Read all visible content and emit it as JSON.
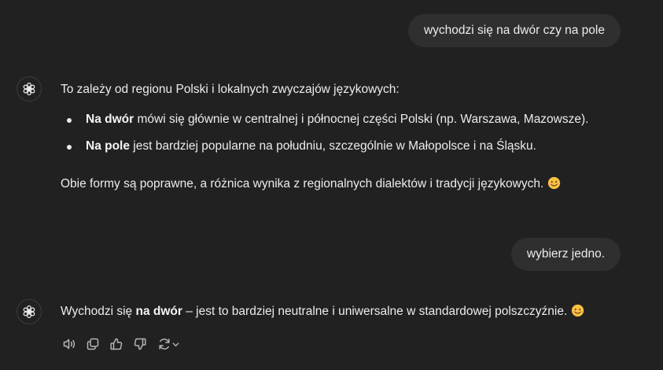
{
  "conversation": [
    {
      "role": "user",
      "text": "wychodzi się na dwór czy na pole"
    },
    {
      "role": "assistant",
      "intro": "To zależy od regionu Polski i lokalnych zwyczajów językowych:",
      "bullets": [
        {
          "bold": "Na dwór",
          "text": " mówi się głównie w centralnej i północnej części Polski (np. Warszawa, Mazowsze)."
        },
        {
          "bold": "Na pole",
          "text": " jest bardziej popularne na południu, szczególnie w Małopolsce i na Śląsku."
        }
      ],
      "outro": "Obie formy są poprawne, a różnica wynika z regionalnych dialektów i tradycji językowych.",
      "emoji": "smiling-face-emoji"
    },
    {
      "role": "user",
      "text": "wybierz jedno."
    },
    {
      "role": "assistant",
      "prefix": "Wychodzi się ",
      "bold": "na dwór",
      "suffix": " – jest to bardziej neutralne i uniwersalne w standardowej polszczyźnie.",
      "emoji": "smiling-face-emoji"
    }
  ],
  "action_icons": [
    "read-aloud-icon",
    "copy-icon",
    "thumbs-up-icon",
    "thumbs-down-icon",
    "regenerate-icon",
    "chevron-down-icon"
  ],
  "colors": {
    "background": "#212121",
    "user_bubble": "#2f2f2f",
    "text": "#ececec",
    "icon": "#b4b4b4"
  }
}
